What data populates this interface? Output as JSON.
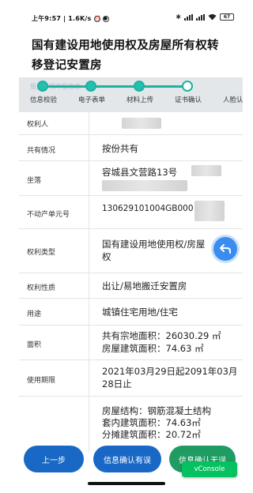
{
  "status_bar": {
    "time": "上午9:57",
    "net_speed": "1.6K/s",
    "battery": "67"
  },
  "page_title": "国有建设用地使用权及房屋所有权转移登记安置房",
  "stepper": {
    "hint": "服务事项申报信息",
    "steps": [
      {
        "label": "信息校验",
        "done": true
      },
      {
        "label": "电子表单",
        "done": true
      },
      {
        "label": "材料上传",
        "done": true
      },
      {
        "label": "证书确认",
        "done": false
      },
      {
        "label": "人脸认",
        "done": false
      }
    ]
  },
  "rows": {
    "right_holder": {
      "label": "权利人",
      "value": ""
    },
    "co_ownership": {
      "label": "共有情况",
      "value": "按份共有"
    },
    "location": {
      "label": "坐落",
      "value": "容城县文营路13号"
    },
    "unit_number": {
      "label": "不动产单元号",
      "value": "130629101004GB000"
    },
    "right_type": {
      "label": "权利类型",
      "line1": "国有建设用地使用权/房屋",
      "line2": "权"
    },
    "right_nature": {
      "label": "权利性质",
      "value": "出让/易地搬迁安置房"
    },
    "usage": {
      "label": "用途",
      "value": "城镇住宅用地/住宅"
    },
    "area": {
      "label": "面积",
      "line1": "共有宗地面积：26030.29 ㎡",
      "line2": "房屋建筑面积：74.63 ㎡"
    },
    "period": {
      "label": "使用期限",
      "line1": "2021年03月29日起2091年03月",
      "line2": "28日止"
    },
    "structure": {
      "line1": "房屋结构：钢筋混凝土结构",
      "line2": "套内建筑面积：74.63㎡",
      "line3": "分摊建筑面积：20.72㎡"
    }
  },
  "buttons": {
    "prev": "上一步",
    "error": "信息确认有误",
    "ok": "信息确认无误"
  },
  "vconsole": "vConsole",
  "icons": {
    "fab": "return-arrow-icon"
  },
  "colors": {
    "primary": "#1a68c6",
    "success": "#1f9c62",
    "step": "#1fb1a0"
  }
}
